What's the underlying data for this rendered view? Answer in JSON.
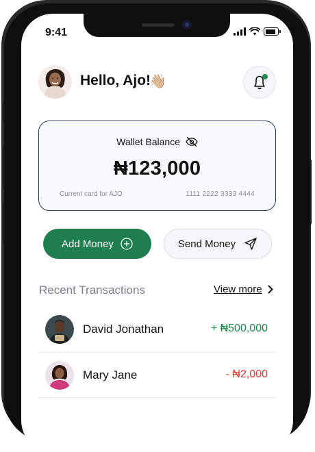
{
  "status_bar": {
    "time": "9:41"
  },
  "header": {
    "greeting": "Hello, Ajo!",
    "wave_icon": "👋🏼",
    "notification_icon": "bell-icon"
  },
  "wallet": {
    "label": "Wallet Balance",
    "amount": "₦123,000",
    "card_holder": "Current card for AJO",
    "card_number": "1111 2222 3333 4444",
    "visibility_icon": "eye-off-icon"
  },
  "actions": {
    "add_money": "Add Money",
    "send_money": "Send Money"
  },
  "transactions": {
    "title": "Recent Transactions",
    "view_more": "View more",
    "items": [
      {
        "name": "David Jonathan",
        "amount": "+ ₦500,000",
        "color": "#1f8a4c"
      },
      {
        "name": "Mary Jane",
        "amount": "- ₦2,000",
        "color": "#e53935"
      }
    ]
  },
  "colors": {
    "primary": "#1e7e4e",
    "card_border": "#263b53",
    "credit": "#1f8a4c",
    "debit": "#e53935"
  }
}
